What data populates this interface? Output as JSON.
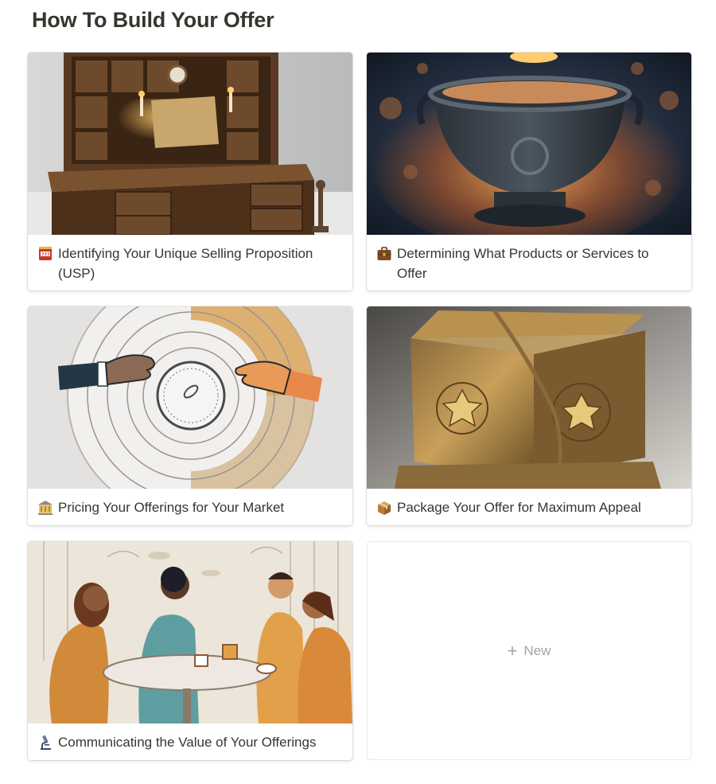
{
  "page": {
    "title": "How To Build Your Offer"
  },
  "cards": [
    {
      "title": "Identifying Your Unique Selling Proposition (USP)",
      "icon": "slot-machine-icon"
    },
    {
      "title": "Determining What Products or Services to Offer",
      "icon": "briefcase-icon"
    },
    {
      "title": "Pricing Your Offerings for Your Market",
      "icon": "bank-icon"
    },
    {
      "title": "Package Your Offer for Maximum Appeal",
      "icon": "package-icon"
    },
    {
      "title": "Communicating the Value of Your Offerings",
      "icon": "microscope-icon"
    }
  ],
  "new_card": {
    "label": "New",
    "icon": "plus-icon"
  }
}
